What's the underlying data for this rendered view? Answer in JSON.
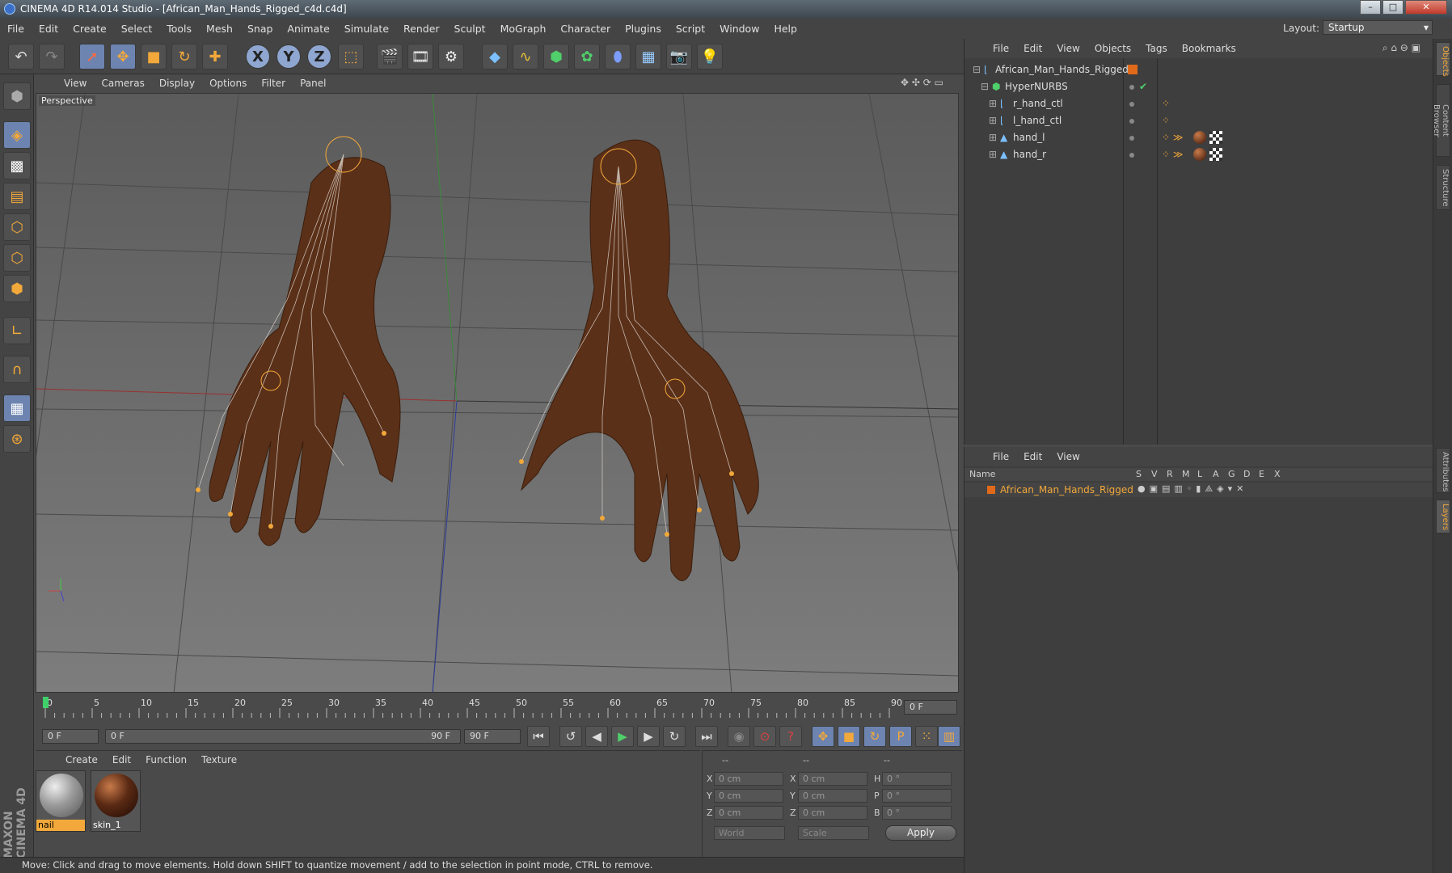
{
  "window": {
    "title": "CINEMA 4D R14.014 Studio - [African_Man_Hands_Rigged_c4d.c4d]"
  },
  "menubar": {
    "items": [
      "File",
      "Edit",
      "Create",
      "Select",
      "Tools",
      "Mesh",
      "Snap",
      "Animate",
      "Simulate",
      "Render",
      "Sculpt",
      "MoGraph",
      "Character",
      "Plugins",
      "Script",
      "Window",
      "Help"
    ],
    "layout_label": "Layout:",
    "layout_value": "Startup"
  },
  "viewport": {
    "menu": [
      "View",
      "Cameras",
      "Display",
      "Options",
      "Filter",
      "Panel"
    ],
    "label": "Perspective"
  },
  "timeline": {
    "ticks": [
      "0",
      "5",
      "10",
      "15",
      "20",
      "25",
      "30",
      "35",
      "40",
      "45",
      "50",
      "55",
      "60",
      "65",
      "70",
      "75",
      "80",
      "85",
      "90"
    ],
    "current_frame": "0 F",
    "start_field": "0 F",
    "range_start": "0 F",
    "range_end": "90 F",
    "end_field": "90 F"
  },
  "material_manager": {
    "menu": [
      "Create",
      "Edit",
      "Function",
      "Texture"
    ],
    "materials": [
      {
        "name": "nail",
        "color": "#9a9a9a",
        "selected": true
      },
      {
        "name": "skin_1",
        "color": "#5a2a14",
        "selected": false
      }
    ]
  },
  "coordinates": {
    "headers": [
      "--",
      "--",
      "--"
    ],
    "rows": [
      {
        "l1": "X",
        "v1": "0 cm",
        "l2": "X",
        "v2": "0 cm",
        "l3": "H",
        "v3": "0 °"
      },
      {
        "l1": "Y",
        "v1": "0 cm",
        "l2": "Y",
        "v2": "0 cm",
        "l3": "P",
        "v3": "0 °"
      },
      {
        "l1": "Z",
        "v1": "0 cm",
        "l2": "Z",
        "v2": "0 cm",
        "l3": "B",
        "v3": "0 °"
      }
    ],
    "space": "World",
    "mode": "Scale",
    "apply": "Apply"
  },
  "status": "Move: Click and drag to move elements. Hold down SHIFT to quantize movement / add to the selection in point mode, CTRL to remove.",
  "object_manager": {
    "menu": [
      "File",
      "Edit",
      "View",
      "Objects",
      "Tags",
      "Bookmarks"
    ],
    "objects": [
      {
        "name": "African_Man_Hands_Rigged",
        "depth": 0
      },
      {
        "name": "HyperNURBS",
        "depth": 1
      },
      {
        "name": "r_hand_ctl",
        "depth": 2
      },
      {
        "name": "l_hand_ctl",
        "depth": 2
      },
      {
        "name": "hand_l",
        "depth": 2
      },
      {
        "name": "hand_r",
        "depth": 2
      }
    ]
  },
  "layer_manager": {
    "menu": [
      "File",
      "Edit",
      "View"
    ],
    "column_name": "Name",
    "columns": [
      "S",
      "V",
      "R",
      "M",
      "L",
      "A",
      "G",
      "D",
      "E",
      "X"
    ],
    "layers": [
      {
        "name": "African_Man_Hands_Rigged",
        "color": "#e06a1a"
      }
    ]
  },
  "side_tabs": [
    "Objects",
    "Content Browser",
    "Structure",
    "Attributes",
    "Layers"
  ],
  "brand": "MAXON CINEMA 4D",
  "colors": {
    "accent": "#f2a83a",
    "selection": "#6d84b0"
  }
}
